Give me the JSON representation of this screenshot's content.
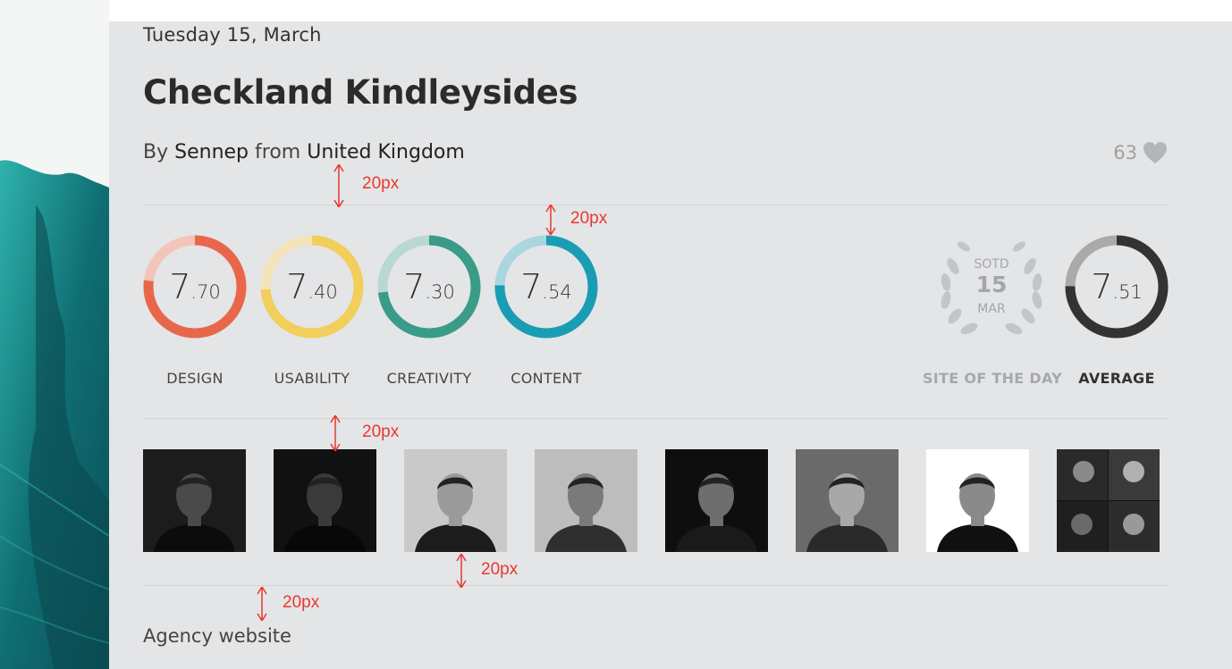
{
  "header": {
    "date": "Tuesday 15, March",
    "title": "Checkland Kindleysides",
    "by_prefix": "By",
    "author": "Sennep",
    "from_prefix": "from",
    "country": "United Kingdom",
    "likes": "63"
  },
  "scores": [
    {
      "int": "7",
      "dec": ".70",
      "label": "DESIGN",
      "value": 0.77,
      "color": "#e8674b",
      "track": "#f2c5bb"
    },
    {
      "int": "7",
      "dec": ".40",
      "label": "USABILITY",
      "value": 0.74,
      "color": "#f2ce5a",
      "track": "#f3e4b9"
    },
    {
      "int": "7",
      "dec": ".30",
      "label": "CREATIVITY",
      "value": 0.73,
      "color": "#3a9b89",
      "track": "#b9d8d2"
    },
    {
      "int": "7",
      "dec": ".54",
      "label": "CONTENT",
      "value": 0.754,
      "color": "#1a9db4",
      "track": "#a9d6df"
    }
  ],
  "sotd": {
    "line1": "SOTD",
    "line2": "15",
    "line3": "MAR",
    "label": "SITE OF THE DAY"
  },
  "average": {
    "int": "7",
    "dec": ".51",
    "label": "AVERAGE",
    "value": 0.751,
    "color": "#333333",
    "track": "#aaaaaa"
  },
  "jury_count": 8,
  "category": "Agency website",
  "annotations": [
    "20px",
    "20px",
    "20px",
    "20px",
    "20px"
  ],
  "colors": {
    "background": "#e4e5e7",
    "annotation": "#e8382f"
  }
}
